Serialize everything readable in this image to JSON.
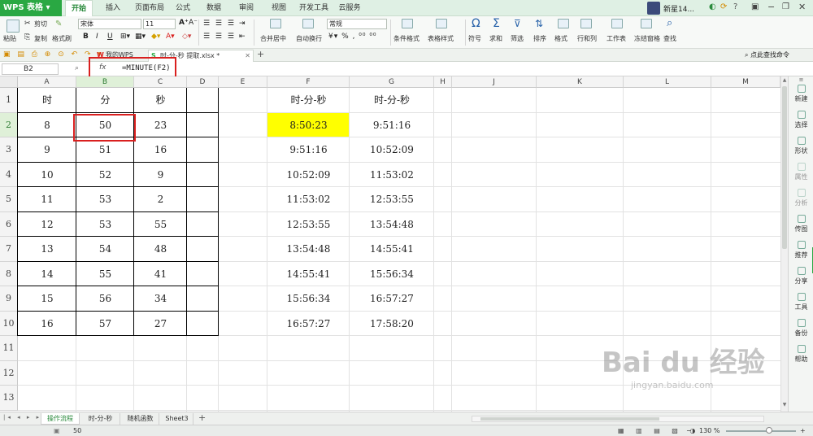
{
  "title_bar": {
    "app_name": "WPS 表格",
    "menu": [
      "开始",
      "插入",
      "页面布局",
      "公式",
      "数据",
      "审阅",
      "视图",
      "开发工具",
      "云服务"
    ],
    "active_menu": "开始",
    "user_name": "新星14..."
  },
  "ribbon": {
    "cut": "剪切",
    "paste": "粘贴",
    "copy": "复制",
    "format_painter": "格式刷",
    "font_name": "宋体",
    "font_size": "11",
    "number_format": "常规",
    "merge_center": "合并居中",
    "wrap_text": "自动换行",
    "cond_format": "条件格式",
    "table_style": "表格样式",
    "symbol": "符号",
    "sum": "求和",
    "filter": "筛选",
    "sort": "排序",
    "format": "格式",
    "rows_cols": "行和列",
    "worksheet": "工作表",
    "freeze": "冻结窗格",
    "find": "查找",
    "bold": "B",
    "italic": "I",
    "underline": "U"
  },
  "doc_tabs": [
    {
      "label": "我的WPS",
      "active": false
    },
    {
      "label": "时-分-秒 提取.xlsx *",
      "active": true
    }
  ],
  "search_hint": "点此查找命令",
  "formula_bar": {
    "cell_ref": "B2",
    "fx": "fx",
    "formula": "=MINUTE(F2)"
  },
  "columns": [
    "A",
    "B",
    "C",
    "D",
    "E",
    "F",
    "G",
    "H",
    "J",
    "K",
    "L",
    "M"
  ],
  "rows": [
    "1",
    "2",
    "3",
    "4",
    "5",
    "6",
    "7",
    "8",
    "9",
    "10",
    "11",
    "12",
    "13"
  ],
  "table_left": {
    "headers": [
      "时",
      "分",
      "秒"
    ],
    "rows": [
      [
        "8",
        "50",
        "23"
      ],
      [
        "9",
        "51",
        "16"
      ],
      [
        "10",
        "52",
        "9"
      ],
      [
        "11",
        "53",
        "2"
      ],
      [
        "12",
        "53",
        "55"
      ],
      [
        "13",
        "54",
        "48"
      ],
      [
        "14",
        "55",
        "41"
      ],
      [
        "15",
        "56",
        "34"
      ],
      [
        "16",
        "57",
        "27"
      ]
    ]
  },
  "table_right": {
    "headers": [
      "时-分-秒",
      "时-分-秒"
    ],
    "rows": [
      [
        "8:50:23",
        "9:51:16"
      ],
      [
        "9:51:16",
        "10:52:09"
      ],
      [
        "10:52:09",
        "11:53:02"
      ],
      [
        "11:53:02",
        "12:53:55"
      ],
      [
        "12:53:55",
        "13:54:48"
      ],
      [
        "13:54:48",
        "14:55:41"
      ],
      [
        "14:55:41",
        "15:56:34"
      ],
      [
        "15:56:34",
        "16:57:27"
      ],
      [
        "16:57:27",
        "17:58:20"
      ]
    ]
  },
  "highlight_color": "#ffff00",
  "accent_color": "#2aa843",
  "right_panel": [
    "新建",
    "选择",
    "形状",
    "属性",
    "分析",
    "传图",
    "推荐",
    "分享",
    "工具",
    "备份",
    "帮助"
  ],
  "sheet_tabs": [
    "操作流程",
    "时-分-秒",
    "随机函数",
    "Sheet3"
  ],
  "active_sheet": "操作流程",
  "status": {
    "value": "50",
    "zoom": "130 %"
  },
  "watermark": {
    "brand": "Bai du 经验",
    "url": "jingyan.baidu.com"
  }
}
